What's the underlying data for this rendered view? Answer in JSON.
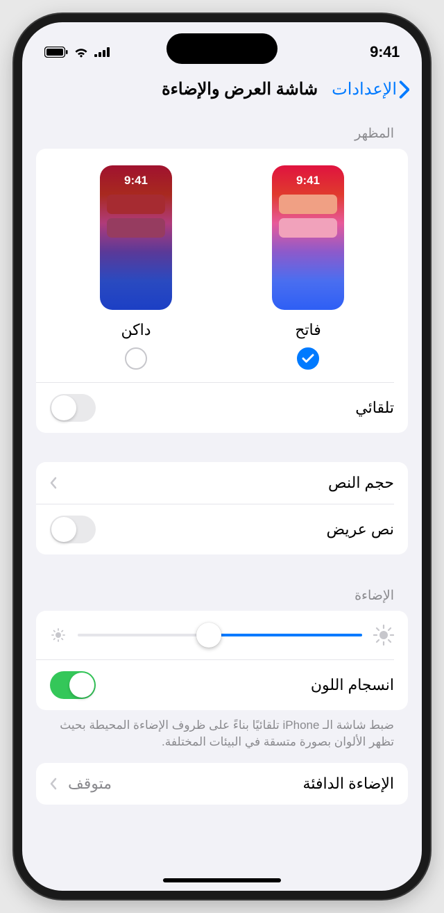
{
  "status": {
    "time": "9:41"
  },
  "nav": {
    "back_label": "الإعدادات",
    "title": "شاشة العرض والإضاءة"
  },
  "appearance": {
    "header": "المظهر",
    "mini_time": "9:41",
    "light_label": "فاتح",
    "dark_label": "داكن",
    "selected": "light",
    "automatic_label": "تلقائي",
    "automatic_on": false
  },
  "text": {
    "size_label": "حجم النص",
    "bold_label": "نص عريض",
    "bold_on": false
  },
  "brightness": {
    "header": "الإضاءة",
    "value_percent": 54,
    "true_tone_label": "انسجام اللون",
    "true_tone_on": true,
    "note": "ضبط شاشة الـ iPhone تلقائيًا بناءً على ظروف الإضاءة المحيطة بحيث تظهر الألوان بصورة متسقة في البيئات المختلفة."
  },
  "night_shift": {
    "label": "الإضاءة الدافئة",
    "value": "متوقف"
  }
}
